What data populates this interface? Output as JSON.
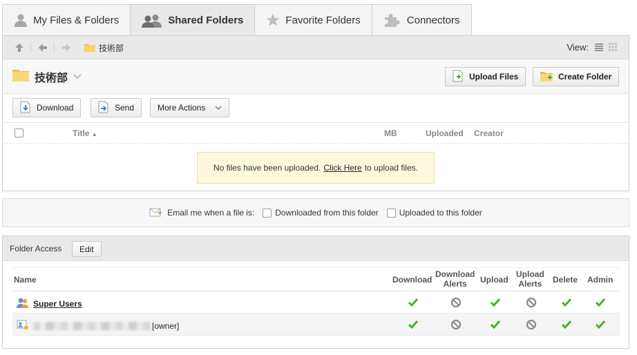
{
  "tabs": [
    {
      "label": "My Files & Folders",
      "icon": "user-icon"
    },
    {
      "label": "Shared Folders",
      "icon": "users-icon"
    },
    {
      "label": "Favorite Folders",
      "icon": "star-icon"
    },
    {
      "label": "Connectors",
      "icon": "puzzle-icon"
    }
  ],
  "nav": {
    "breadcrumb": "技術部",
    "view_label": "View:"
  },
  "folder": {
    "title": "技術部",
    "upload_button": "Upload Files",
    "create_button": "Create Folder"
  },
  "actions": {
    "download": "Download",
    "send": "Send",
    "more": "More Actions"
  },
  "columns": {
    "title": "Title",
    "mb": "MB",
    "uploaded": "Uploaded",
    "creator": "Creator"
  },
  "notice": {
    "prefix": "No files have been uploaded.",
    "link": "Click Here",
    "suffix": "to upload files."
  },
  "email": {
    "label": "Email me when a file is:",
    "opt_downloaded": "Downloaded from this folder",
    "opt_uploaded": "Uploaded to this folder"
  },
  "access": {
    "title": "Folder Access",
    "edit": "Edit",
    "headers": {
      "name": "Name",
      "download": "Download",
      "download_alerts_1": "Download",
      "download_alerts_2": "Alerts",
      "upload": "Upload",
      "upload_alerts_1": "Upload",
      "upload_alerts_2": "Alerts",
      "delete": "Delete",
      "admin": "Admin"
    },
    "rows": [
      {
        "name": "Super Users",
        "suffix": "",
        "perms": [
          "check",
          "no",
          "check",
          "no",
          "check",
          "check"
        ]
      },
      {
        "name": "",
        "suffix": "[owner]",
        "perms": [
          "check",
          "no",
          "check",
          "no",
          "check",
          "check"
        ]
      }
    ]
  },
  "colors": {
    "check": "#4caf20",
    "no": "#8a8a8a",
    "folder": "#f5c84c"
  }
}
